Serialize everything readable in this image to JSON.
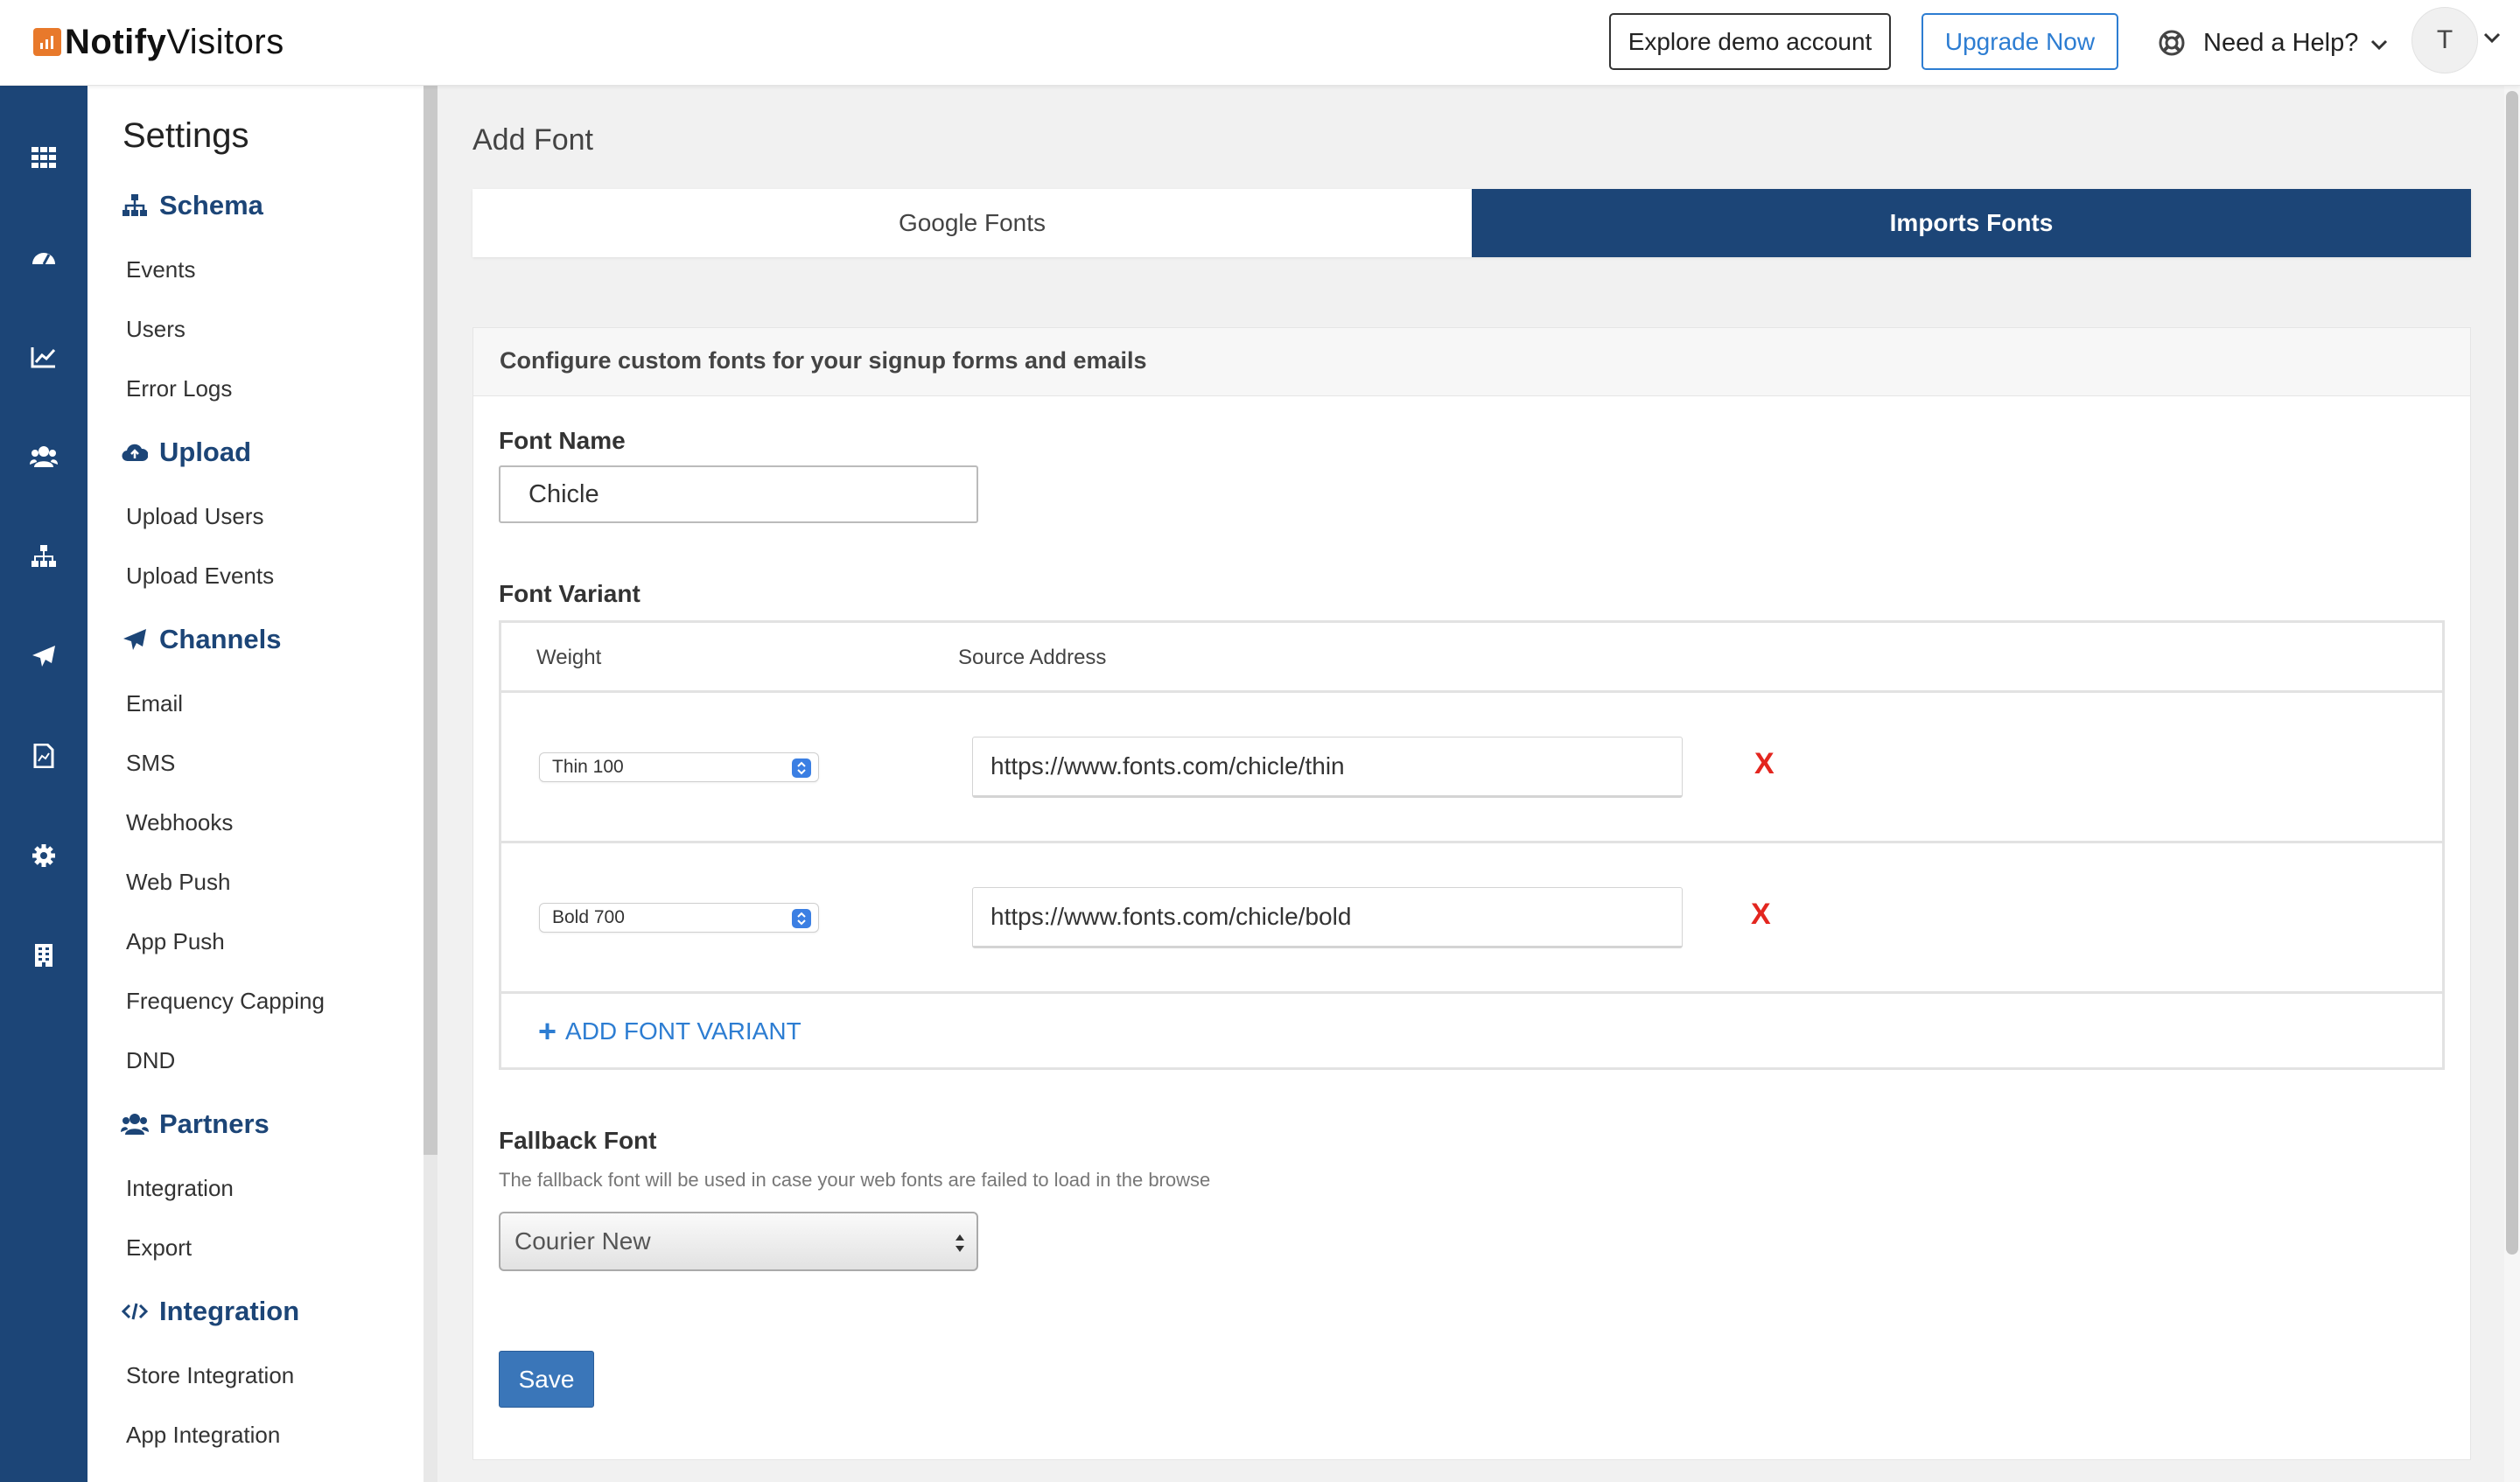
{
  "header": {
    "logo_bold": "Notify",
    "logo_light": "Visitors",
    "demo_button": "Explore demo account",
    "upgrade_button": "Upgrade Now",
    "help_label": "Need a Help?",
    "avatar_initial": "T"
  },
  "rail": {
    "icons": [
      "grid-icon",
      "dashboard-icon",
      "analytics-icon",
      "users-icon",
      "hierarchy-icon",
      "send-icon",
      "report-icon",
      "settings-icon",
      "building-icon"
    ]
  },
  "sidebar": {
    "title": "Settings",
    "sections": [
      {
        "label": "Schema",
        "icon": "sitemap-icon",
        "items": [
          "Events",
          "Users",
          "Error Logs"
        ]
      },
      {
        "label": "Upload",
        "icon": "cloud-upload-icon",
        "items": [
          "Upload Users",
          "Upload Events"
        ]
      },
      {
        "label": "Channels",
        "icon": "paper-plane-icon",
        "items": [
          "Email",
          "SMS",
          "Webhooks",
          "Web Push",
          "App Push",
          "Frequency Capping",
          "DND"
        ]
      },
      {
        "label": "Partners",
        "icon": "users-icon",
        "items": [
          "Integration",
          "Export"
        ]
      },
      {
        "label": "Integration",
        "icon": "code-icon",
        "items": [
          "Store Integration",
          "App Integration"
        ]
      }
    ]
  },
  "main": {
    "page_title": "Add Font",
    "tabs": [
      {
        "label": "Google Fonts",
        "active": false
      },
      {
        "label": "Imports Fonts",
        "active": true
      }
    ],
    "card_heading": "Configure custom fonts for your signup forms and emails",
    "font_name_label": "Font Name",
    "font_name_value": "Chicle",
    "font_variant_label": "Font Variant",
    "variant_columns": [
      "Weight",
      "Source Address"
    ],
    "variants": [
      {
        "weight": "Thin 100",
        "source": "https://www.fonts.com/chicle/thin",
        "remove": "X"
      },
      {
        "weight": "Bold 700",
        "source": "https://www.fonts.com/chicle/bold",
        "remove": "X"
      }
    ],
    "add_variant_plus": "+",
    "add_variant_label": "ADD FONT VARIANT",
    "fallback_label": "Fallback Font",
    "fallback_help": "The fallback font will be used in case your web fonts are failed to load in the browse",
    "fallback_value": "Courier New",
    "save_button": "Save"
  },
  "colors": {
    "brand_navy": "#1c4577",
    "link_blue": "#2d7dd2",
    "danger_red": "#e3261f",
    "save_blue": "#3a76b9"
  }
}
